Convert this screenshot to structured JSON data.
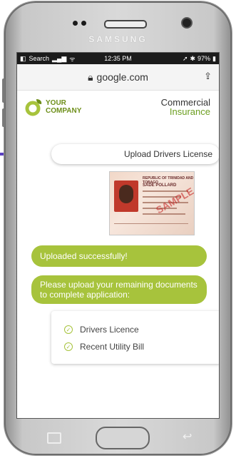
{
  "device": {
    "brand": "SAMSUNG"
  },
  "status_bar": {
    "back_label": "Search",
    "time": "12:35 PM",
    "battery": "97%"
  },
  "browser": {
    "url": "google.com"
  },
  "header": {
    "logo_line1": "YOUR",
    "logo_line2": "COMPANY",
    "title_line1": "Commercial",
    "title_line2": "Insurance"
  },
  "chat": {
    "upload_message": "Upload Drivers License",
    "uploaded_message": "Uploaded successfully!",
    "remaining_message": "Please upload your remaining documents to complete application:",
    "documents": [
      {
        "label": "Drivers Licence"
      },
      {
        "label": "Recent Utility Bill"
      }
    ]
  },
  "license_card": {
    "header": "REPUBLIC OF TRINIDAD AND TOBAGO",
    "name": "SADE POLLARD",
    "stamp": "SAMPLE"
  },
  "colors": {
    "accent_green": "#a7c33c",
    "logo_green": "#6e8f1a",
    "accent_bar": "#5a3fc0"
  }
}
